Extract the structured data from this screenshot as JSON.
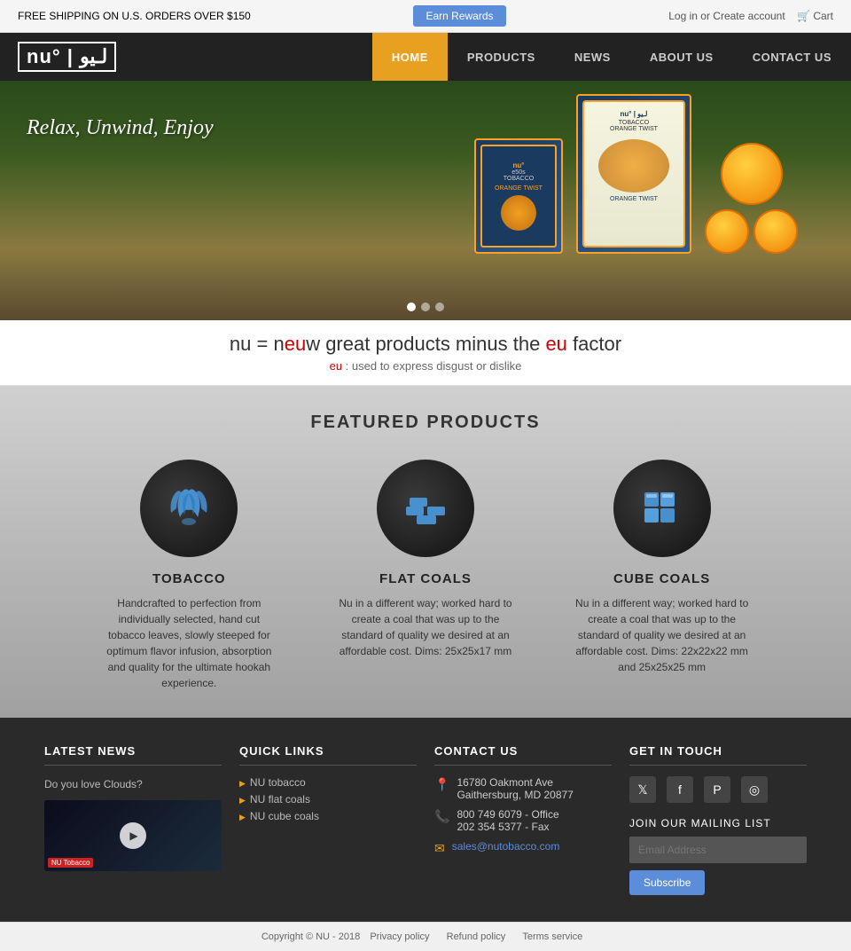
{
  "topbar": {
    "shipping_text": "FREE SHIPPING ON U.S. ORDERS OVER $150",
    "earn_rewards_label": "Earn Rewards",
    "login_label": "Log in",
    "or_label": " or ",
    "create_account_label": "Create account",
    "cart_label": "Cart"
  },
  "nav": {
    "logo_text": "nu° | لـيو",
    "items": [
      {
        "label": "HOME",
        "active": true
      },
      {
        "label": "PRODUCTS",
        "active": false
      },
      {
        "label": "NEWS",
        "active": false
      },
      {
        "label": "ABOUT US",
        "active": false
      },
      {
        "label": "CONTACT US",
        "active": false
      }
    ]
  },
  "hero": {
    "tagline": "Relax, Unwind, Enjoy",
    "main_text_prefix": "nu = n",
    "main_text_highlight1": "eu",
    "main_text_middle": "w great products minus the ",
    "main_text_highlight2": "eu",
    "main_text_suffix": " factor",
    "sub_text_prefix": "",
    "sub_text_highlight": "eu",
    "sub_text_suffix": " : used to express disgust or dislike"
  },
  "featured": {
    "title": "FEATURED PRODUCTS",
    "products": [
      {
        "name": "TOBACCO",
        "description": "Handcrafted to perfection from individually selected, hand cut tobacco leaves, slowly steeped for optimum flavor infusion, absorption and quality for the ultimate hookah experience."
      },
      {
        "name": "FLAT COALS",
        "description": "Nu in a different way; worked hard to create a coal that was up to the standard of quality we desired at an affordable cost. Dims: 25x25x17 mm"
      },
      {
        "name": "CUBE COALS",
        "description": "Nu in a different way; worked hard to create a coal that was up to the standard of quality we desired at an affordable cost. Dims: 22x22x22 mm and 25x25x25 mm"
      }
    ]
  },
  "footer": {
    "latest_news": {
      "title": "LATEST NEWS",
      "item_label": "Do you love Clouds?"
    },
    "quick_links": {
      "title": "QUICK LINKS",
      "links": [
        {
          "label": "NU tobacco"
        },
        {
          "label": "NU flat coals"
        },
        {
          "label": "NU cube coals"
        }
      ]
    },
    "contact": {
      "title": "CONTACT US",
      "address_line1": "16780 Oakmont Ave",
      "address_line2": "Gaithersburg, MD 20877",
      "phone": "800 749 6079 - Office",
      "fax": "202 354 5377 - Fax",
      "email": "sales@nutobacco.com"
    },
    "get_in_touch": {
      "title": "GET IN TOUCH",
      "mailing_title": "JOIN OUR MAILING LIST",
      "email_placeholder": "Email Address",
      "subscribe_label": "Subscribe"
    }
  },
  "bottom_bar": {
    "copyright": "Copyright © NU - 2018",
    "privacy_label": "Privacy policy",
    "refund_label": "Refund policy",
    "terms_label": "Terms service"
  }
}
